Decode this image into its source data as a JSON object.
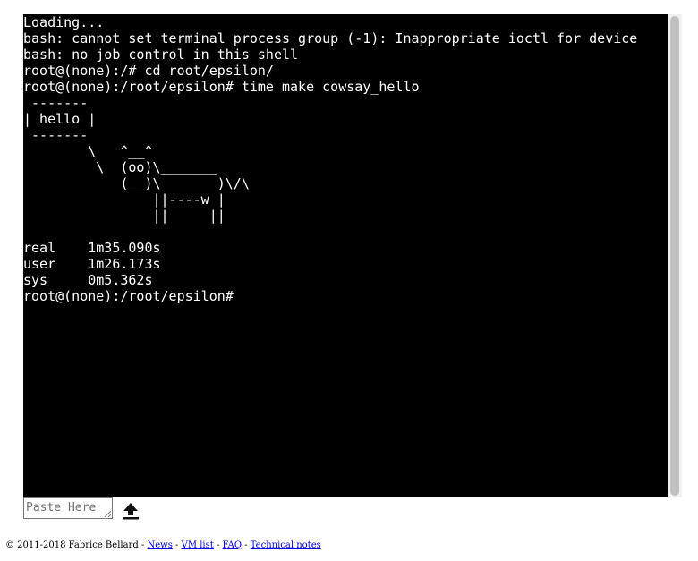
{
  "terminal": {
    "lines": [
      "Loading...",
      "bash: cannot set terminal process group (-1): Inappropriate ioctl for device",
      "bash: no job control in this shell",
      "root@(none):/# cd root/epsilon/",
      "root@(none):/root/epsilon# time make cowsay_hello",
      " -------",
      "| hello |",
      " -------",
      "        \\   ^__^",
      "         \\  (oo)\\_______",
      "            (__)\\       )\\/\\",
      "                ||----w |",
      "                ||     ||",
      "",
      "real    1m35.090s",
      "user    1m26.173s",
      "sys     0m5.362s",
      "root@(none):/root/epsilon# "
    ]
  },
  "paste": {
    "placeholder": "Paste Here"
  },
  "upload": {
    "icon": "upload-icon"
  },
  "footer": {
    "copyright": "© 2011-2018 Fabrice Bellard - ",
    "links": [
      "News",
      "VM list",
      "FAQ",
      "Technical notes"
    ],
    "separator": " - "
  },
  "colors": {
    "terminal_bg": "#000000",
    "terminal_fg": "#ffffff",
    "link": "#0000ee"
  }
}
